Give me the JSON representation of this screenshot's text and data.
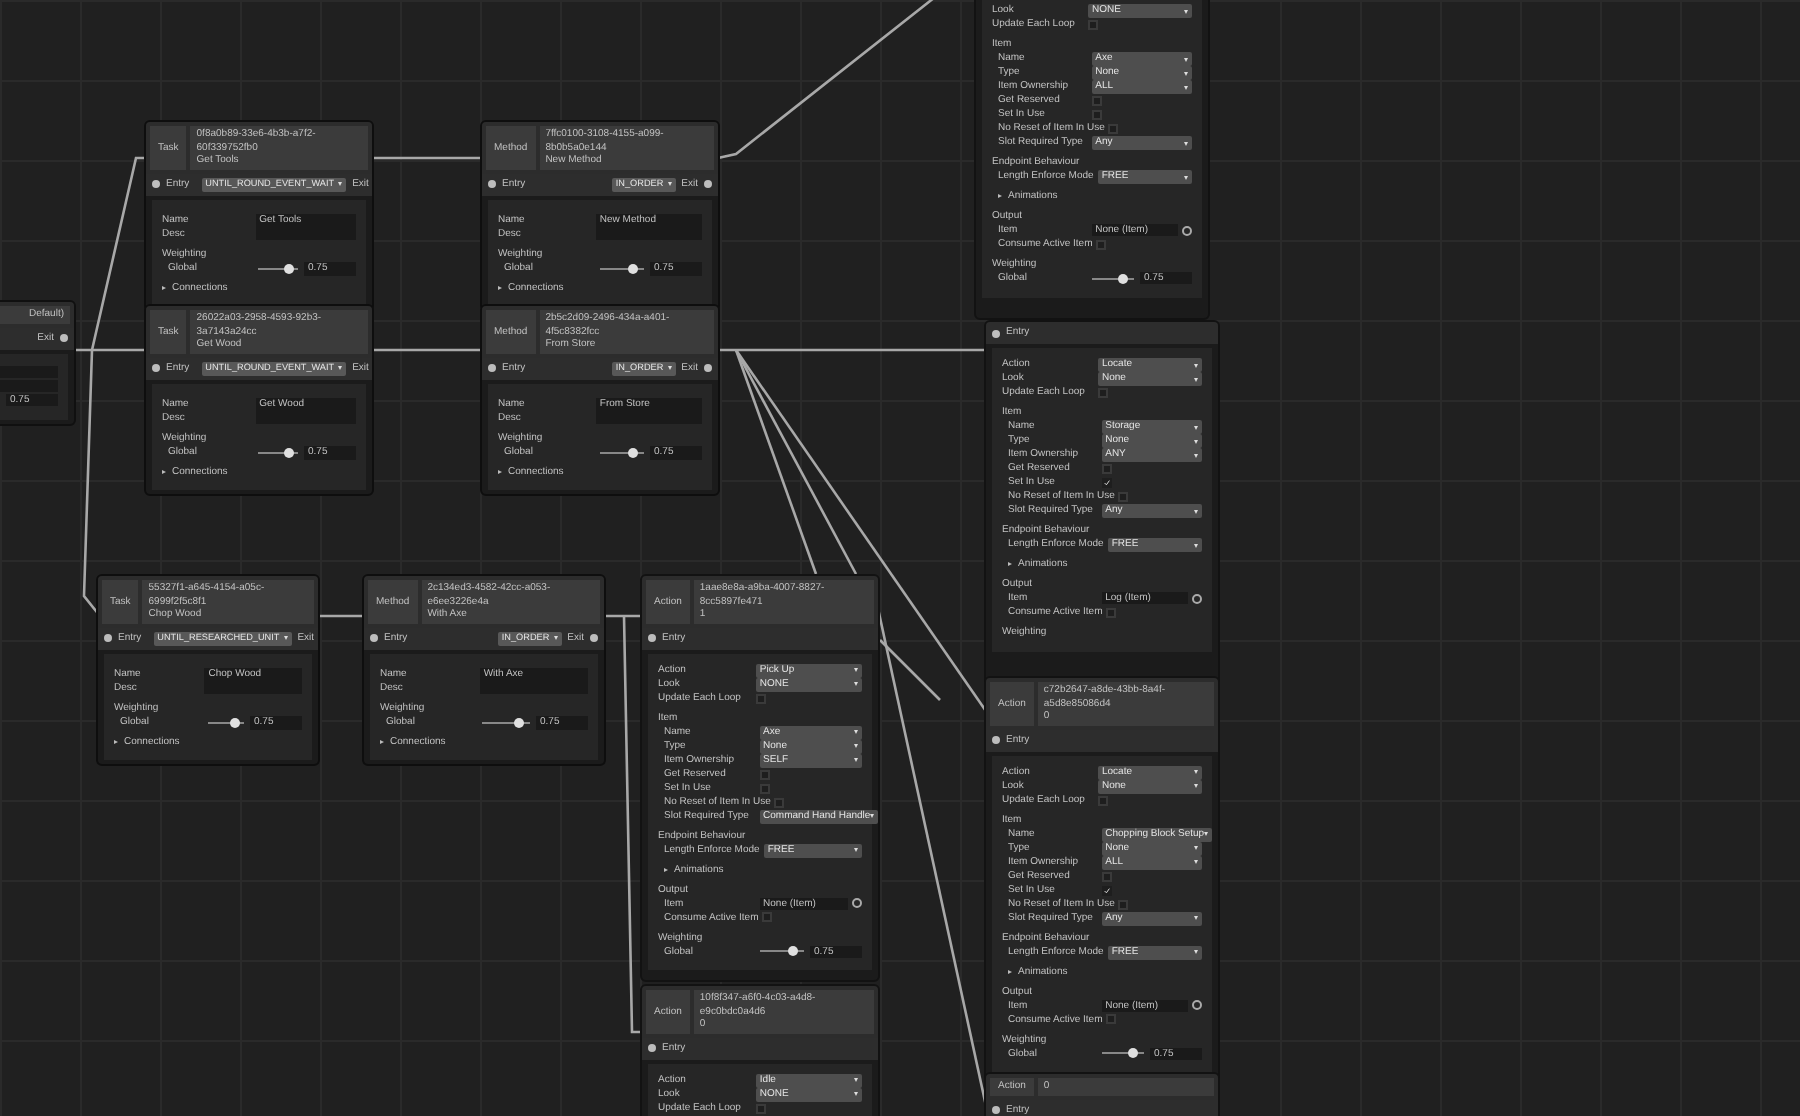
{
  "nodes": [
    {
      "kind": "partial",
      "header": {
        "id_text": "Default)"
      },
      "port": {
        "exit": "Exit"
      },
      "rows": [
        {
          "kind": "field"
        },
        {
          "kind": "field"
        },
        {
          "kind": "slider",
          "reading": "0.75"
        }
      ]
    },
    {
      "kind": "task",
      "header": {
        "type_label": "Task",
        "id_text": "0f8a0b89-33e6-4b3b-a7f2-60f339752fb0\nGet Tools"
      },
      "port": {
        "entry": "Entry",
        "dropdown": "UNTIL_ROUND_EVENT_WAIT",
        "exit": "Exit"
      },
      "rows": [
        {
          "kind": "field",
          "label": "Name",
          "value": "Get Tools"
        },
        {
          "kind": "field",
          "label": "Desc"
        },
        {
          "kind": "heading",
          "label": "Weighting",
          "children": [
            {
              "kind": "slider",
              "label": "Global",
              "level": 0.75,
              "reading": "0.75"
            }
          ]
        },
        {
          "kind": "foldout",
          "label": "Connections",
          "expanded": false
        }
      ]
    },
    {
      "kind": "method",
      "header": {
        "type_label": "Method",
        "id_text": "7ffc0100-3108-4155-a099-8b0b5a0e144\nNew Method"
      },
      "port": {
        "entry": "Entry",
        "dropdown": "IN_ORDER",
        "exit": "Exit"
      },
      "rows": [
        {
          "kind": "field",
          "label": "Name",
          "value": "New Method"
        },
        {
          "kind": "field",
          "label": "Desc"
        },
        {
          "kind": "heading",
          "label": "Weighting",
          "children": [
            {
              "kind": "slider",
              "label": "Global",
              "level": 0.75,
              "reading": "0.75"
            }
          ]
        },
        {
          "kind": "foldout",
          "label": "Connections",
          "expanded": false
        }
      ]
    },
    {
      "kind": "task",
      "header": {
        "type_label": "Task",
        "id_text": "26022a03-2958-4593-92b3-3a7143a24cc\nGet Wood"
      },
      "port": {
        "entry": "Entry",
        "dropdown": "UNTIL_ROUND_EVENT_WAIT",
        "exit": "Exit"
      },
      "rows": [
        {
          "kind": "field",
          "label": "Name",
          "value": "Get Wood"
        },
        {
          "kind": "field",
          "label": "Desc"
        },
        {
          "kind": "heading",
          "label": "Weighting",
          "children": [
            {
              "kind": "slider",
              "label": "Global",
              "level": 0.75,
              "reading": "0.75"
            }
          ]
        },
        {
          "kind": "foldout",
          "label": "Connections",
          "expanded": false
        }
      ]
    },
    {
      "kind": "method",
      "header": {
        "type_label": "Method",
        "id_text": "2b5c2d09-2496-434a-a401-4f5c8382fcc\nFrom Store"
      },
      "port": {
        "entry": "Entry",
        "dropdown": "IN_ORDER",
        "exit": "Exit"
      },
      "rows": [
        {
          "kind": "field",
          "label": "Name",
          "value": "From Store"
        },
        {
          "kind": "field",
          "label": "Desc"
        },
        {
          "kind": "heading",
          "label": "Weighting",
          "children": [
            {
              "kind": "slider",
              "label": "Global",
              "level": 0.75,
              "reading": "0.75"
            }
          ]
        },
        {
          "kind": "foldout",
          "label": "Connections",
          "expanded": false
        }
      ]
    },
    {
      "kind": "task",
      "header": {
        "type_label": "Task",
        "id_text": "55327f1-a645-4154-a05c-6999f2f5c8f1\nChop Wood"
      },
      "port": {
        "entry": "Entry",
        "dropdown": "UNTIL_RESEARCHED_UNIT",
        "exit": "Exit"
      },
      "rows": [
        {
          "kind": "field",
          "label": "Name",
          "value": "Chop Wood"
        },
        {
          "kind": "field",
          "label": "Desc"
        },
        {
          "kind": "heading",
          "label": "Weighting",
          "children": [
            {
              "kind": "slider",
              "label": "Global",
              "level": 0.75,
              "reading": "0.75"
            }
          ]
        },
        {
          "kind": "foldout",
          "label": "Connections",
          "expanded": false
        }
      ]
    },
    {
      "kind": "method",
      "header": {
        "type_label": "Method",
        "id_text": "2c134ed3-4582-42cc-a053-e6ee3226e4a\nWith Axe"
      },
      "port": {
        "entry": "Entry",
        "dropdown": "IN_ORDER",
        "exit": "Exit"
      },
      "rows": [
        {
          "kind": "field",
          "label": "Name",
          "value": "With Axe"
        },
        {
          "kind": "field",
          "label": "Desc"
        },
        {
          "kind": "heading",
          "label": "Weighting",
          "children": [
            {
              "kind": "slider",
              "label": "Global",
              "level": 0.75,
              "reading": "0.75"
            }
          ]
        },
        {
          "kind": "foldout",
          "label": "Connections",
          "expanded": false
        }
      ]
    },
    {
      "kind": "action",
      "header": {
        "type_label": "Action",
        "id_text": "1aae8e8a-a9ba-4007-8827-8cc5897fe471\n1"
      },
      "port": {
        "entry": "Entry"
      },
      "rows": [
        {
          "kind": "dropdown",
          "label": "Action",
          "value": "Pick Up"
        },
        {
          "kind": "dropdown",
          "label": "Look",
          "value": "NONE"
        },
        {
          "kind": "check",
          "label": "Update Each Loop",
          "checked": false
        },
        {
          "kind": "heading",
          "label": "Item",
          "children": [
            {
              "kind": "dropdown",
              "label": "Name",
              "value": "Axe"
            },
            {
              "kind": "dropdown",
              "label": "Type",
              "value": "None"
            },
            {
              "kind": "dropdown",
              "label": "Item Ownership",
              "value": "SELF"
            },
            {
              "kind": "check",
              "label": "Get Reserved",
              "checked": false
            },
            {
              "kind": "check",
              "label": "Set In Use",
              "checked": false
            },
            {
              "kind": "check",
              "label": "No Reset of Item In Use",
              "checked": false
            },
            {
              "kind": "dropdown",
              "label": "Slot Required Type",
              "value": "Command Hand Handle"
            }
          ]
        },
        {
          "kind": "heading",
          "label": "Endpoint Behaviour",
          "children": [
            {
              "kind": "dropdown",
              "label": "Length Enforce Mode",
              "value": "FREE"
            },
            {
              "kind": "foldout",
              "label": "Animations",
              "expanded": false
            }
          ]
        },
        {
          "kind": "heading",
          "label": "Output",
          "children": [
            {
              "kind": "object",
              "label": "Item",
              "value": "None (Item)"
            },
            {
              "kind": "check",
              "label": "Consume Active Item",
              "checked": false
            }
          ]
        },
        {
          "kind": "heading",
          "label": "Weighting",
          "children": [
            {
              "kind": "slider",
              "label": "Global",
              "level": 0.75,
              "reading": "0.75"
            }
          ]
        }
      ]
    },
    {
      "kind": "action",
      "header": {
        "type_label": "Action",
        "id_text": "10f8f347-a6f0-4c03-a4d8-e9c0bdc0a4d6\n0"
      },
      "port": {
        "entry": "Entry"
      },
      "rows": [
        {
          "kind": "dropdown",
          "label": "Action",
          "value": "Idle"
        },
        {
          "kind": "dropdown",
          "label": "Look",
          "value": "NONE"
        },
        {
          "kind": "check",
          "label": "Update Each Loop",
          "checked": false
        }
      ]
    },
    {
      "kind": "action",
      "rows": [
        {
          "kind": "dropdown",
          "label": "Look",
          "value": "NONE"
        },
        {
          "kind": "check",
          "label": "Update Each Loop",
          "checked": false
        },
        {
          "kind": "heading",
          "label": "Item",
          "children": [
            {
              "kind": "dropdown",
              "label": "Name",
              "value": "Axe"
            },
            {
              "kind": "dropdown",
              "label": "Type",
              "value": "None"
            },
            {
              "kind": "dropdown",
              "label": "Item Ownership",
              "value": "ALL"
            },
            {
              "kind": "check",
              "label": "Get Reserved",
              "checked": false
            },
            {
              "kind": "check",
              "label": "Set In Use",
              "checked": false
            },
            {
              "kind": "check",
              "label": "No Reset of Item In Use",
              "checked": false
            },
            {
              "kind": "dropdown",
              "label": "Slot Required Type",
              "value": "Any"
            }
          ]
        },
        {
          "kind": "heading",
          "label": "Endpoint Behaviour",
          "children": [
            {
              "kind": "dropdown",
              "label": "Length Enforce Mode",
              "value": "FREE"
            },
            {
              "kind": "foldout",
              "label": "Animations",
              "expanded": false
            }
          ]
        },
        {
          "kind": "heading",
          "label": "Output",
          "children": [
            {
              "kind": "object",
              "label": "Item",
              "value": "None (Item)"
            },
            {
              "kind": "check",
              "label": "Consume Active Item",
              "checked": false
            }
          ]
        },
        {
          "kind": "heading",
          "label": "Weighting",
          "children": [
            {
              "kind": "slider",
              "label": "Global",
              "level": 0.75,
              "reading": "0.75"
            }
          ]
        }
      ]
    },
    {
      "kind": "action",
      "port": {
        "entry": "Entry"
      },
      "rows": [
        {
          "kind": "dropdown",
          "label": "Action",
          "value": "Locate"
        },
        {
          "kind": "dropdown",
          "label": "Look",
          "value": "None"
        },
        {
          "kind": "check",
          "label": "Update Each Loop",
          "checked": false
        },
        {
          "kind": "heading",
          "label": "Item",
          "children": [
            {
              "kind": "dropdown",
              "label": "Name",
              "value": "Storage"
            },
            {
              "kind": "dropdown",
              "label": "Type",
              "value": "None"
            },
            {
              "kind": "dropdown",
              "label": "Item Ownership",
              "value": "ANY"
            },
            {
              "kind": "check",
              "label": "Get Reserved",
              "checked": false
            },
            {
              "kind": "check",
              "label": "Set In Use",
              "checked": true
            },
            {
              "kind": "check",
              "label": "No Reset of Item In Use",
              "checked": false
            },
            {
              "kind": "dropdown",
              "label": "Slot Required Type",
              "value": "Any"
            }
          ]
        },
        {
          "kind": "heading",
          "label": "Endpoint Behaviour",
          "children": [
            {
              "kind": "dropdown",
              "label": "Length Enforce Mode",
              "value": "FREE"
            },
            {
              "kind": "foldout",
              "label": "Animations",
              "expanded": false
            }
          ]
        },
        {
          "kind": "heading",
          "label": "Output",
          "children": [
            {
              "kind": "object",
              "label": "Item",
              "value": "Log (Item)"
            },
            {
              "kind": "check",
              "label": "Consume Active Item",
              "checked": false
            }
          ]
        },
        {
          "kind": "heading",
          "label": "Weighting"
        }
      ]
    },
    {
      "kind": "action",
      "header": {
        "type_label": "Action",
        "id_text": "c72b2647-a8de-43bb-8a4f-a5d8e85086d4\n0"
      },
      "port": {
        "entry": "Entry"
      },
      "rows": [
        {
          "kind": "dropdown",
          "label": "Action",
          "value": "Locate"
        },
        {
          "kind": "dropdown",
          "label": "Look",
          "value": "None"
        },
        {
          "kind": "check",
          "label": "Update Each Loop",
          "checked": false
        },
        {
          "kind": "heading",
          "label": "Item",
          "children": [
            {
              "kind": "dropdown",
              "label": "Name",
              "value": "Chopping Block Setup"
            },
            {
              "kind": "dropdown",
              "label": "Type",
              "value": "None"
            },
            {
              "kind": "dropdown",
              "label": "Item Ownership",
              "value": "ALL"
            },
            {
              "kind": "check",
              "label": "Get Reserved",
              "checked": false
            },
            {
              "kind": "check",
              "label": "Set In Use",
              "checked": true
            },
            {
              "kind": "check",
              "label": "No Reset of Item In Use",
              "checked": false
            },
            {
              "kind": "dropdown",
              "label": "Slot Required Type",
              "value": "Any"
            }
          ]
        },
        {
          "kind": "heading",
          "label": "Endpoint Behaviour",
          "children": [
            {
              "kind": "dropdown",
              "label": "Length Enforce Mode",
              "value": "FREE"
            },
            {
              "kind": "foldout",
              "label": "Animations",
              "expanded": false
            }
          ]
        },
        {
          "kind": "heading",
          "label": "Output",
          "children": [
            {
              "kind": "object",
              "label": "Item",
              "value": "None (Item)"
            },
            {
              "kind": "check",
              "label": "Consume Active Item",
              "checked": false
            }
          ]
        },
        {
          "kind": "heading",
          "label": "Weighting",
          "children": [
            {
              "kind": "slider",
              "label": "Global",
              "level": 0.75,
              "reading": "0.75"
            }
          ]
        }
      ]
    },
    {
      "kind": "action",
      "header": {
        "type_label": "Action",
        "id_text": "0"
      },
      "port": {
        "entry": "Entry"
      }
    }
  ]
}
